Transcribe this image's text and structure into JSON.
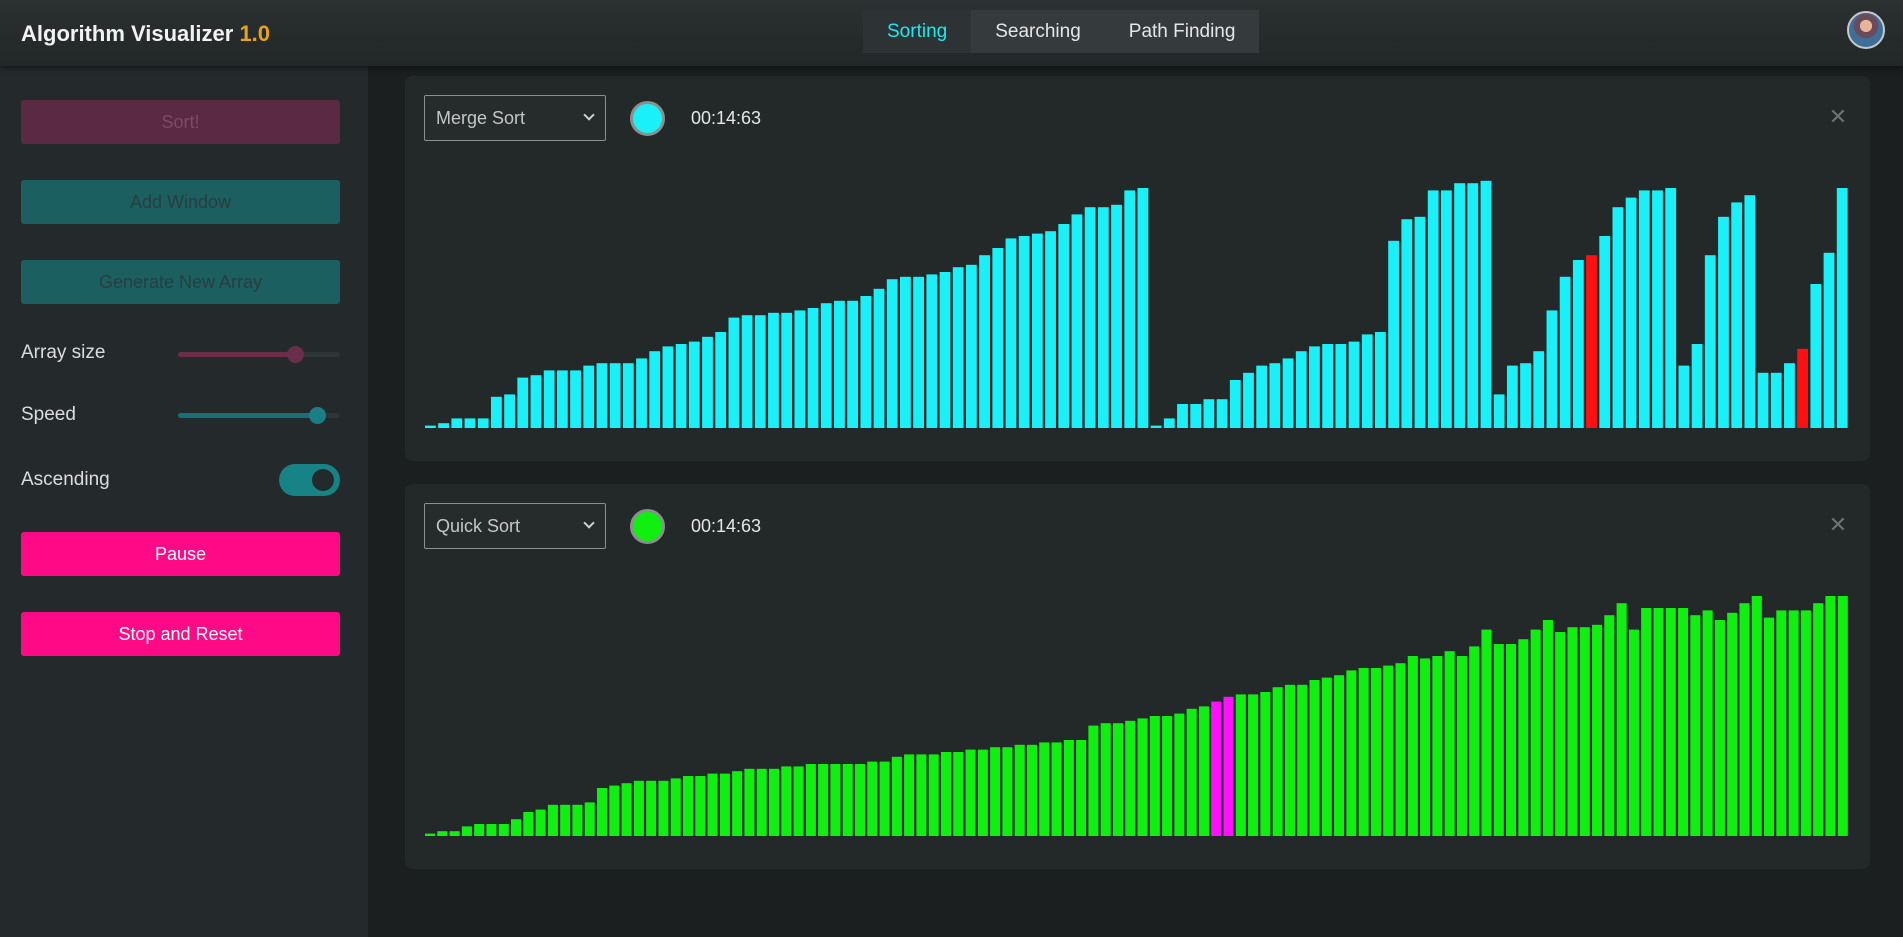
{
  "app": {
    "title": "Algorithm Visualizer",
    "version": "1.0"
  },
  "tabs": [
    {
      "label": "Sorting",
      "active": true
    },
    {
      "label": "Searching",
      "active": false
    },
    {
      "label": "Path Finding",
      "active": false
    }
  ],
  "sidebar": {
    "sort_label": "Sort!",
    "add_window_label": "Add Window",
    "generate_label": "Generate New Array",
    "array_size_label": "Array size",
    "array_size_level": 0.72,
    "speed_label": "Speed",
    "speed_level": 0.86,
    "ascending_label": "Ascending",
    "ascending_on": true,
    "pause_label": "Pause",
    "stop_label": "Stop and Reset"
  },
  "windows": [
    {
      "algorithm": "Merge Sort",
      "color": "#19f0f7",
      "timer": "00:14:63",
      "close_icon": "close-icon",
      "chart_data": {
        "type": "bar",
        "bar_color": "#19f0f7",
        "highlight_color": "#ff1010",
        "max": 100,
        "values": [
          1,
          2,
          4,
          4,
          4,
          13,
          14,
          21,
          22,
          24,
          24,
          24,
          26,
          27,
          27,
          27,
          29,
          32,
          34,
          35,
          36,
          38,
          40,
          46,
          47,
          47,
          48,
          48,
          49,
          50,
          52,
          53,
          53,
          55,
          58,
          62,
          63,
          63,
          64,
          65,
          67,
          68,
          72,
          75,
          79,
          80,
          81,
          82,
          85,
          89,
          92,
          92,
          93,
          99,
          100,
          1,
          4,
          10,
          10,
          12,
          12,
          20,
          23,
          26,
          27,
          29,
          32,
          34,
          35,
          35,
          36,
          39,
          40,
          78,
          87,
          88,
          99,
          99,
          102,
          102,
          103,
          14,
          26,
          27,
          32,
          49,
          63,
          70,
          72,
          80,
          92,
          96,
          99,
          99,
          100,
          26,
          35,
          72,
          88,
          94,
          97,
          23,
          23,
          27,
          33,
          60,
          73,
          100
        ],
        "highlight_indices": [
          88,
          104
        ]
      }
    },
    {
      "algorithm": "Quick Sort",
      "color": "#10f010",
      "timer": "00:14:63",
      "close_icon": "close-icon",
      "chart_data": {
        "type": "bar",
        "bar_color": "#10f010",
        "highlight_color": "#ff10ff",
        "max": 100,
        "values": [
          1,
          2,
          2,
          4,
          5,
          5,
          5,
          7,
          10,
          11,
          13,
          13,
          13,
          14,
          20,
          21,
          22,
          23,
          23,
          23,
          24,
          25,
          25,
          26,
          26,
          27,
          28,
          28,
          28,
          29,
          29,
          30,
          30,
          30,
          30,
          30,
          31,
          31,
          33,
          34,
          34,
          34,
          35,
          35,
          36,
          36,
          37,
          37,
          38,
          38,
          39,
          39,
          40,
          40,
          46,
          47,
          47,
          48,
          49,
          50,
          50,
          51,
          53,
          54,
          56,
          58,
          59,
          59,
          60,
          62,
          63,
          63,
          65,
          66,
          67,
          69,
          70,
          70,
          71,
          72,
          75,
          74,
          75,
          77,
          75,
          79,
          86,
          80,
          80,
          82,
          86,
          90,
          85,
          87,
          87,
          88,
          92,
          97,
          86,
          95,
          95,
          95,
          95,
          92,
          94,
          90,
          93,
          97,
          100,
          91,
          94,
          94,
          94,
          97,
          100,
          100
        ],
        "highlight_indices": [
          64,
          65
        ]
      }
    }
  ]
}
